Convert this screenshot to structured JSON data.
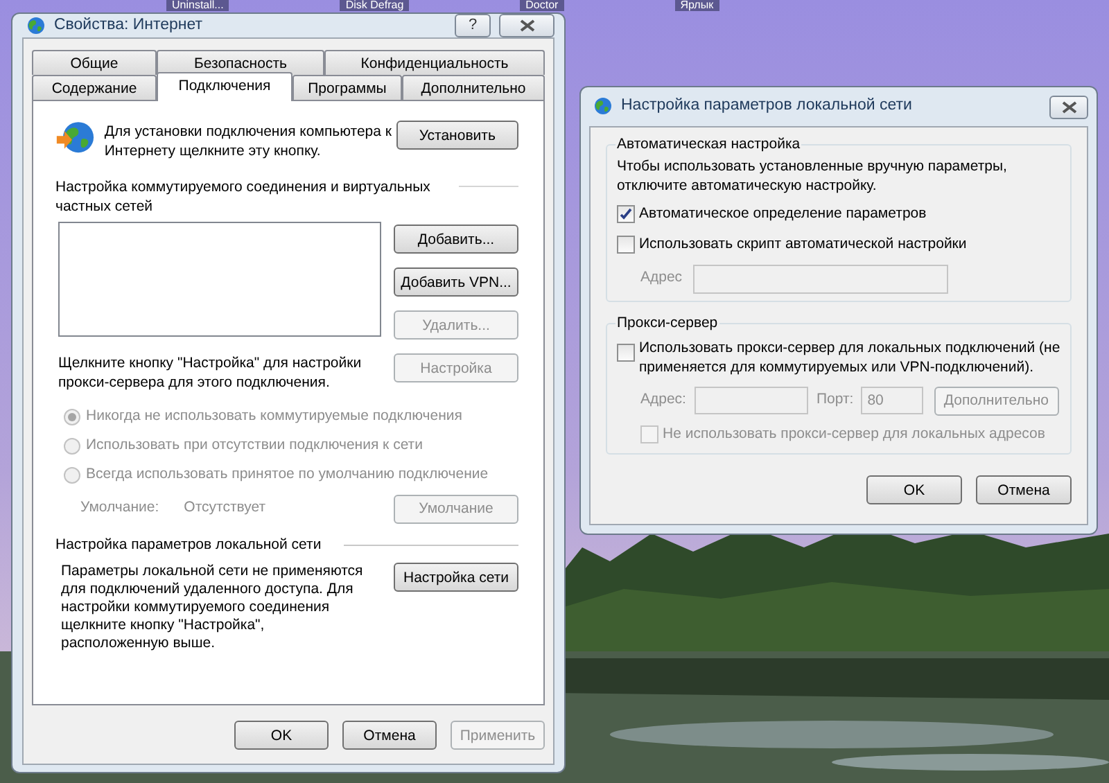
{
  "desktop": {
    "icon_labels": [
      "Uninstall...",
      "Disk Defrag",
      "Doctor",
      "Ярлык"
    ]
  },
  "internet_properties": {
    "title": "Свойства: Интернет",
    "help_label": "?",
    "tab_rows": [
      [
        {
          "label": "Общие",
          "selected": false
        },
        {
          "label": "Безопасность",
          "selected": false
        },
        {
          "label": "Конфиденциальность",
          "selected": false
        }
      ],
      [
        {
          "label": "Содержание",
          "selected": false
        },
        {
          "label": "Подключения",
          "selected": true
        },
        {
          "label": "Программы",
          "selected": false
        },
        {
          "label": "Дополнительно",
          "selected": false
        }
      ]
    ],
    "setup_text": "Для установки подключения компьютера к Интернету щелкните эту кнопку.",
    "setup_button": {
      "label": "Установить",
      "disabled": false
    },
    "dialup_heading": "Настройка коммутируемого соединения и виртуальных частных сетей",
    "dialup_buttons": [
      {
        "label": "Добавить...",
        "disabled": false
      },
      {
        "label": "Добавить VPN...",
        "disabled": false
      },
      {
        "label": "Удалить...",
        "disabled": true
      }
    ],
    "proxy_hint": "Щелкните кнопку \"Настройка\" для настройки прокси-сервера для этого подключения.",
    "proxy_button": {
      "label": "Настройка",
      "disabled": true
    },
    "dial_options": [
      {
        "label": "Никогда не использовать коммутируемые подключения",
        "selected": true,
        "disabled": true
      },
      {
        "label": "Использовать при отсутствии подключения к сети",
        "selected": false,
        "disabled": true
      },
      {
        "label": "Всегда использовать принятое по умолчанию подключение",
        "selected": false,
        "disabled": true
      }
    ],
    "default_label": "Умолчание:",
    "default_value": "Отсутствует",
    "default_button": {
      "label": "Умолчание",
      "disabled": true
    },
    "lan_heading": "Настройка параметров локальной сети",
    "lan_text": "Параметры локальной сети не применяются для подключений удаленного доступа. Для настройки коммутируемого соединения щелкните кнопку \"Настройка\", расположенную выше.",
    "lan_button": {
      "label": "Настройка сети",
      "disabled": false
    },
    "footer_buttons": [
      {
        "label": "OK",
        "disabled": false
      },
      {
        "label": "Отмена",
        "disabled": false
      },
      {
        "label": "Применить",
        "disabled": true
      }
    ]
  },
  "lan_settings": {
    "title": "Настройка параметров локальной сети",
    "auto_group": {
      "legend": "Автоматическая настройка",
      "hint": "Чтобы использовать установленные вручную параметры, отключите автоматическую настройку.",
      "options": [
        {
          "label": "Автоматическое определение параметров",
          "checked": true,
          "disabled": false
        },
        {
          "label": "Использовать скрипт автоматической настройки",
          "checked": false,
          "disabled": false
        }
      ],
      "address_label": "Адрес"
    },
    "proxy_group": {
      "legend": "Прокси-сервер",
      "use_proxy": {
        "label": "Использовать прокси-сервер для локальных подключений (не применяется для коммутируемых или VPN-подключений).",
        "checked": false,
        "disabled": false
      },
      "address_label": "Адрес:",
      "port_label": "Порт:",
      "port_value": "80",
      "advanced_button": {
        "label": "Дополнительно",
        "disabled": true
      },
      "bypass": {
        "label": "Не использовать прокси-сервер для локальных адресов",
        "checked": false,
        "disabled": true
      }
    },
    "buttons": [
      {
        "label": "OK",
        "disabled": false
      },
      {
        "label": "Отмена",
        "disabled": false
      }
    ]
  }
}
